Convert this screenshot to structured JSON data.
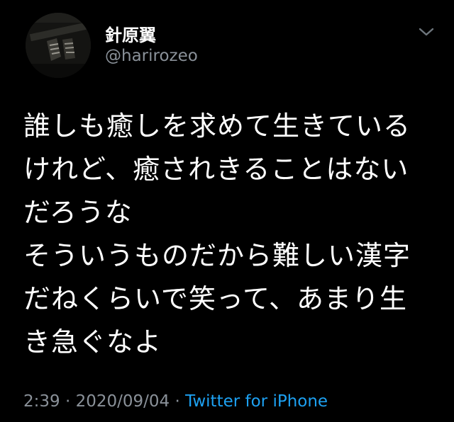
{
  "author": {
    "display_name": "針原翼",
    "handle": "@harirozeo"
  },
  "tweet": {
    "lines": [
      "誰しも癒しを求めて生きている",
      "けれど、癒されきることはない",
      "だろうな",
      "そういうものだから難しい漢字",
      "だねくらいで笑って、あまり生",
      "き急ぐなよ"
    ]
  },
  "meta": {
    "time": "2:39",
    "separator": "·",
    "date": "2020/09/04",
    "source": "Twitter for iPhone"
  },
  "icons": {
    "more": "chevron-down-icon",
    "avatar": "avatar-image"
  },
  "colors": {
    "background": "#000000",
    "text": "#ffffff",
    "secondary": "#8a9199",
    "link": "#1da1f2"
  }
}
